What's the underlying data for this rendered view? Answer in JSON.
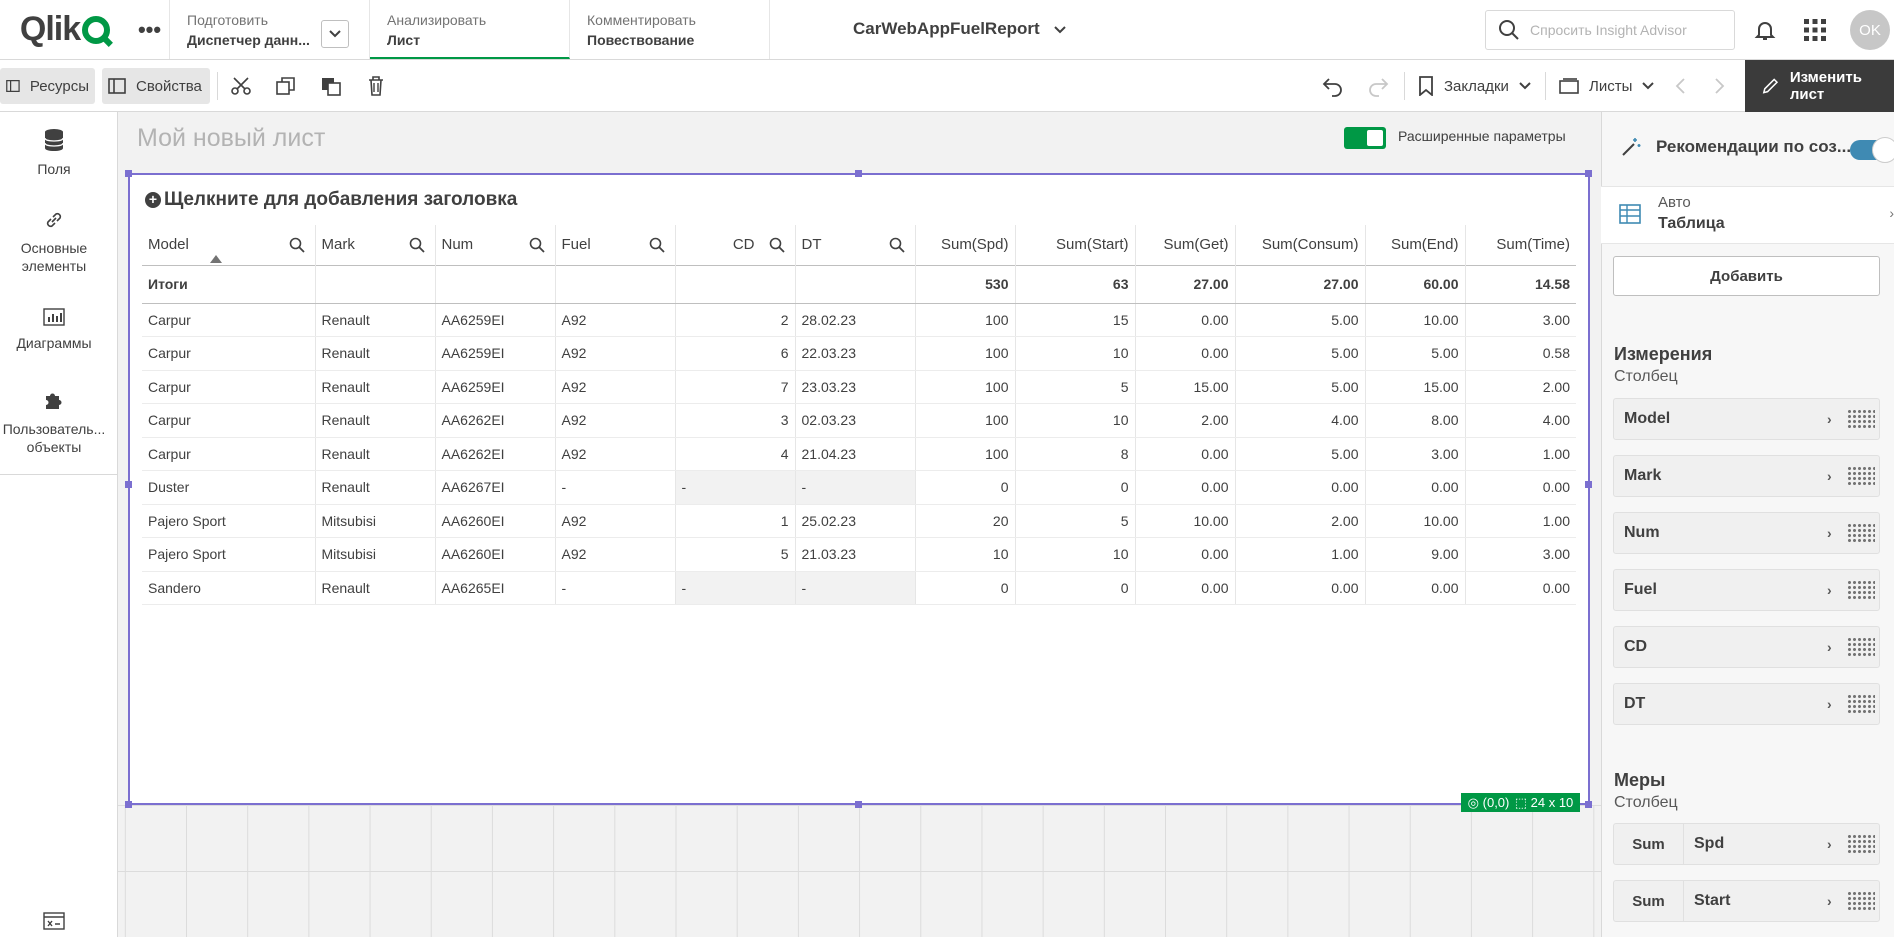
{
  "topnav": {
    "more": "•••",
    "tabs": [
      {
        "top": "Подготовить",
        "bottom": "Диспетчер данн..."
      },
      {
        "top": "Анализировать",
        "bottom": "Лист"
      },
      {
        "top": "Комментировать",
        "bottom": "Повествование"
      }
    ],
    "app_title": "CarWebAppFuelReport",
    "search_placeholder": "Спросить Insight Advisor",
    "avatar": "OK"
  },
  "toolbar": {
    "assets": "Ресурсы",
    "properties": "Свойства",
    "bookmarks": "Закладки",
    "sheets": "Листы",
    "edit_sheet": "Изменить лист"
  },
  "leftpanel": {
    "items": [
      "Поля",
      "Основные элементы",
      "Диаграммы",
      "Пользователь... объекты"
    ]
  },
  "sheet": {
    "title": "Мой новый лист",
    "advanced_label": "Расширенные параметры"
  },
  "object": {
    "title_placeholder": "Щелкните для добавления заголовка",
    "position": "(0,0)",
    "size": "24 x 10"
  },
  "table": {
    "columns": [
      "Model",
      "Mark",
      "Num",
      "Fuel",
      "CD",
      "DT",
      "Sum(Spd)",
      "Sum(Start)",
      "Sum(Get)",
      "Sum(Consum)",
      "Sum(End)",
      "Sum(Time)"
    ],
    "totals_label": "Итоги",
    "totals": [
      "",
      "",
      "",
      "",
      "",
      "",
      "530",
      "63",
      "27.00",
      "27.00",
      "60.00",
      "14.58"
    ],
    "rows": [
      [
        "Carpur",
        "Renault",
        "AA6259EI",
        "A92",
        "2",
        "28.02.23",
        "100",
        "15",
        "0.00",
        "5.00",
        "10.00",
        "3.00"
      ],
      [
        "Carpur",
        "Renault",
        "AA6259EI",
        "A92",
        "6",
        "22.03.23",
        "100",
        "10",
        "0.00",
        "5.00",
        "5.00",
        "0.58"
      ],
      [
        "Carpur",
        "Renault",
        "AA6259EI",
        "A92",
        "7",
        "23.03.23",
        "100",
        "5",
        "15.00",
        "5.00",
        "15.00",
        "2.00"
      ],
      [
        "Carpur",
        "Renault",
        "AA6262EI",
        "A92",
        "3",
        "02.03.23",
        "100",
        "10",
        "2.00",
        "4.00",
        "8.00",
        "4.00"
      ],
      [
        "Carpur",
        "Renault",
        "AA6262EI",
        "A92",
        "4",
        "21.04.23",
        "100",
        "8",
        "0.00",
        "5.00",
        "3.00",
        "1.00"
      ],
      [
        "Duster",
        "Renault",
        "AA6267EI",
        "-",
        "-",
        "-",
        "0",
        "0",
        "0.00",
        "0.00",
        "0.00",
        "0.00"
      ],
      [
        "Pajero Sport",
        "Mitsubisi",
        "AA6260EI",
        "A92",
        "1",
        "25.02.23",
        "20",
        "5",
        "10.00",
        "2.00",
        "10.00",
        "1.00"
      ],
      [
        "Pajero Sport",
        "Mitsubisi",
        "AA6260EI",
        "A92",
        "5",
        "21.03.23",
        "10",
        "10",
        "0.00",
        "1.00",
        "9.00",
        "3.00"
      ],
      [
        "Sandero",
        "Renault",
        "AA6265EI",
        "-",
        "-",
        "-",
        "0",
        "0",
        "0.00",
        "0.00",
        "0.00",
        "0.00"
      ]
    ]
  },
  "rightpanel": {
    "recommendations": "Рекомендации по соз...",
    "viz_top": "Авто",
    "viz_bottom": "Таблица",
    "add": "Добавить",
    "dimensions_title": "Измерения",
    "dimensions_sub": "Столбец",
    "dimensions": [
      "Model",
      "Mark",
      "Num",
      "Fuel",
      "CD",
      "DT"
    ],
    "measures_title": "Меры",
    "measures_sub": "Столбец",
    "measures": [
      {
        "agg": "Sum",
        "field": "Spd"
      },
      {
        "agg": "Sum",
        "field": "Start"
      }
    ]
  }
}
